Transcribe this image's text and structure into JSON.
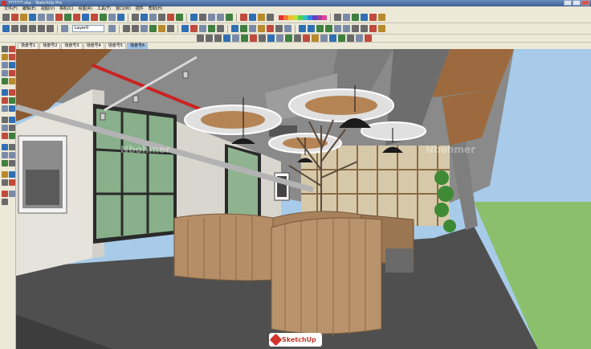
{
  "window": {
    "title": "???????.skp - SketchUp Pro"
  },
  "menu": [
    "文件(F)",
    "编辑(E)",
    "视图(V)",
    "相机(C)",
    "绘图(R)",
    "工具(T)",
    "窗口(W)",
    "插件",
    "帮助(H)"
  ],
  "layer": {
    "selected": "Layer0"
  },
  "scenes": {
    "tabs": [
      "场景号1",
      "场景号2",
      "场景号3",
      "场景号4",
      "场景号5",
      "场景号6"
    ],
    "active_index": 5
  },
  "watermarks": [
    "Nbohmer",
    "Nbohmer"
  ],
  "logo": {
    "text": "SketchUp"
  },
  "colors": {
    "accent": "#9fc2e8",
    "logo": "#d2342b"
  }
}
